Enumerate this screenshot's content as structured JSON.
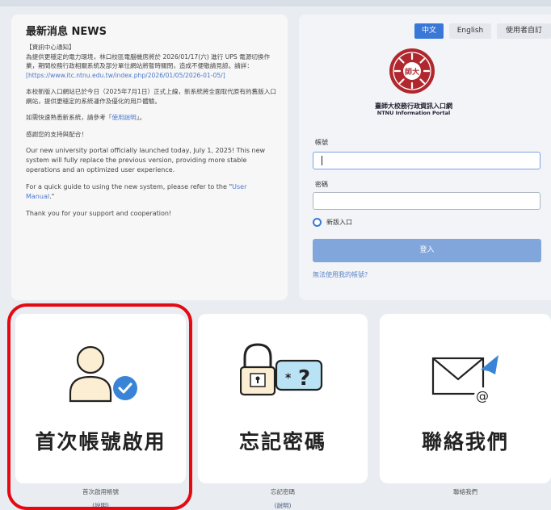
{
  "news": {
    "title": "最新消息 NEWS",
    "notice_header": "【資訊中心通知】",
    "notice_body": "為提供更穩定的電力環境，林口校區電腦機房將於 2026/01/17(六) 進行 UPS 電源切換作業，期間校務行政相關系統及部分單位網站將暫時關閉，造成不便敬請見諒。請詳：",
    "notice_link": "[https://www.itc.ntnu.edu.tw/index.php/2026/01/05/2026-01-05/]",
    "zh_launch": "本校新版入口網站已於今日（2025年7月1日）正式上線，新系統將全面取代原有的舊版入口網站，提供更穩定的系統運作及優化的用戶體驗。",
    "zh_guide_prefix": "如需快速熟悉新系統，請參考「",
    "zh_guide_link": "使用說明",
    "zh_guide_suffix": "」。",
    "zh_thanks": "感謝您的支持與配合！",
    "en_launch": "Our new university portal officially launched today, July 1, 2025! This new system will fully replace the previous version, providing more stable operations and an optimized user experience.",
    "en_guide_prefix": "For a quick guide to using the new system, please refer to the \"",
    "en_guide_link": "User Manual",
    "en_guide_suffix": ".\"",
    "en_thanks": "Thank you for your support and cooperation!"
  },
  "lang": {
    "zh": "中文",
    "en": "English",
    "custom": "使用者自訂"
  },
  "portal": {
    "name_zh": "臺師大校務行政資訊入口網",
    "name_en": "NTNU Information Portal",
    "seal_text": "師大"
  },
  "login": {
    "account_label": "帳號",
    "account_value": "",
    "password_label": "密碼",
    "password_value": "",
    "radio_label": "新版入口",
    "submit": "登入",
    "cant_use": "無法使用我的帳號?"
  },
  "cards": [
    {
      "label": "首次帳號啟用",
      "sub": "首次啟用帳號",
      "sub2": "(說明)"
    },
    {
      "label": "忘記密碼",
      "sub": "忘記密碼",
      "sub2": "(說明)"
    },
    {
      "label": "聯絡我們",
      "sub": "聯絡我們"
    }
  ],
  "colors": {
    "accent": "#3a78d8",
    "highlight": "#e40a12",
    "seal": "#b0282e"
  }
}
